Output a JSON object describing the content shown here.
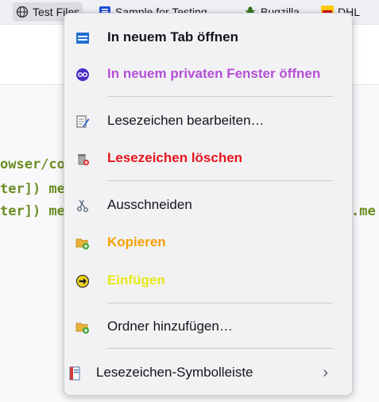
{
  "bookmarks_toolbar": {
    "items": [
      {
        "label": "Test Files",
        "icon": "globe-icon"
      },
      {
        "label": "Sample for Testing",
        "icon": "page-icon"
      },
      {
        "label": "Bugzilla",
        "icon": "bug-icon"
      },
      {
        "label": "DHL",
        "icon": "dhl-icon"
      }
    ]
  },
  "code_lines": [
    "owser/co",
    "ter]) me",
    "ter]) me",
    ".me"
  ],
  "menu": {
    "open_tab": {
      "label": "In neuem Tab öffnen",
      "color": "#15141a"
    },
    "open_private": {
      "label": "In neuem privaten Fenster öffnen",
      "color": "#b44fd6"
    },
    "edit": {
      "label": "Lesezeichen bearbeiten…",
      "color": "#15141a"
    },
    "delete": {
      "label": "Lesezeichen löschen",
      "color": "#e8151b"
    },
    "cut": {
      "label": "Ausschneiden",
      "color": "#15141a"
    },
    "copy": {
      "label": "Kopieren",
      "color": "#f5a100"
    },
    "paste": {
      "label": "Einfügen",
      "color": "#e8e81a"
    },
    "add_folder": {
      "label": "Ordner hinzufügen…",
      "color": "#15141a"
    },
    "toolbar": {
      "label": "Lesezeichen-Symbolleiste",
      "color": "#15141a"
    }
  }
}
